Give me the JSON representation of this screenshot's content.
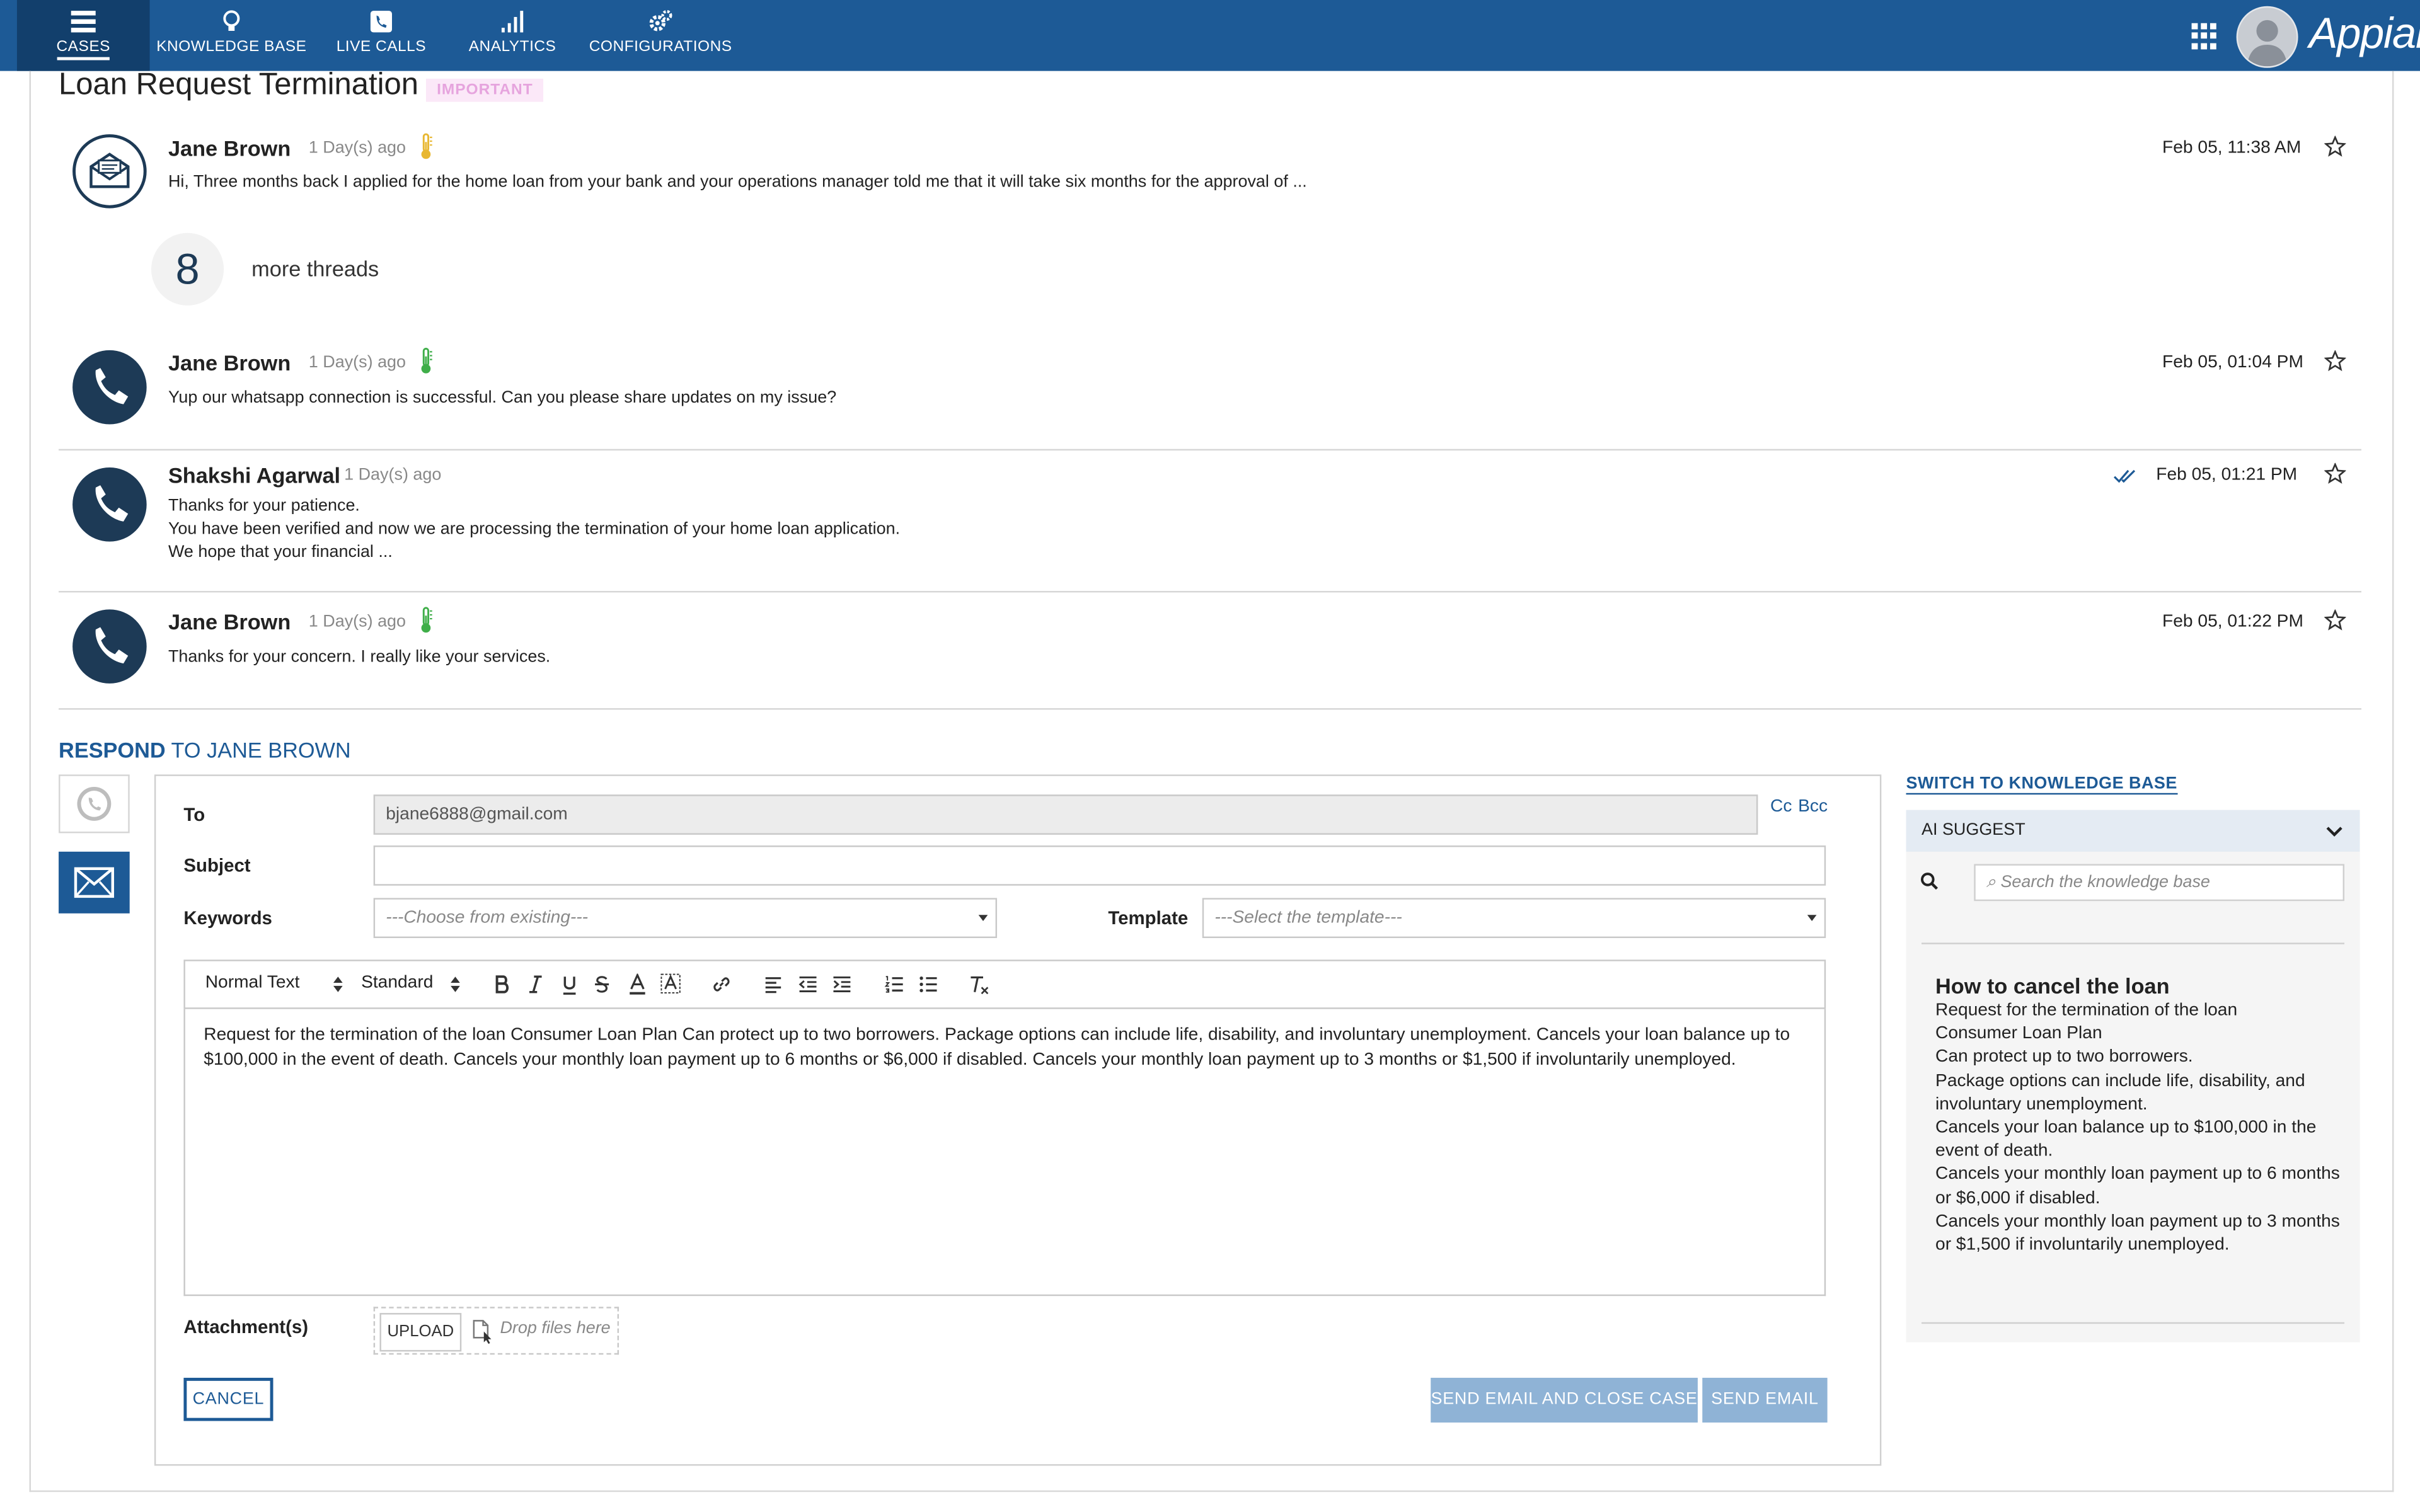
{
  "nav": {
    "items": [
      {
        "label": "CASES",
        "icon": "list-icon"
      },
      {
        "label": "KNOWLEDGE BASE",
        "icon": "lightbulb-icon"
      },
      {
        "label": "LIVE CALLS",
        "icon": "phone-icon"
      },
      {
        "label": "ANALYTICS",
        "icon": "signal-bars-icon"
      },
      {
        "label": "CONFIGURATIONS",
        "icon": "gears-icon"
      }
    ],
    "active": "CASES",
    "brand": "Appian"
  },
  "case": {
    "title": "Loan Request Termination",
    "badge": "IMPORTANT"
  },
  "threads": [
    {
      "name": "Jane Brown",
      "ago": "1 Day(s) ago",
      "date": "Feb 05, 11:38 AM",
      "channel": "email",
      "sentiment": "yellow",
      "text": "Hi, Three months back I applied for the home loan from your bank and your operations manager told me that it will take six months for the approval of ..."
    },
    {
      "name": "Jane Brown",
      "ago": "1 Day(s) ago",
      "date": "Feb 05, 01:04 PM",
      "channel": "whatsapp",
      "sentiment": "green",
      "text": "Yup our whatsapp connection is successful. Can you please share updates on my issue?"
    },
    {
      "name": "Shakshi Agarwal",
      "ago": "1 Day(s) ago",
      "date": "Feb 05, 01:21 PM",
      "channel": "whatsapp",
      "lines": [
        "Thanks for your patience.",
        "You have been verified and now we are processing the termination of your home loan application.",
        "We hope that your financial ..."
      ]
    },
    {
      "name": "Jane Brown",
      "ago": "1 Day(s) ago",
      "date": "Feb 05, 01:22 PM",
      "channel": "whatsapp",
      "sentiment": "green",
      "text": "Thanks for your concern. I really like your services."
    }
  ],
  "more_threads": {
    "count": "8",
    "label": "more threads"
  },
  "respond": {
    "prefix": "RESPOND",
    "suffix": "TO JANE BROWN",
    "to_label": "To",
    "to_value": "bjane6888@gmail.com",
    "cc": "Cc",
    "bcc": "Bcc",
    "subject_label": "Subject",
    "subject_value": "",
    "keywords_label": "Keywords",
    "keywords_placeholder": "---Choose from existing---",
    "template_label": "Template",
    "template_placeholder": "---Select the template---",
    "toolbar": {
      "paragraph": "Normal Text",
      "size": "Standard"
    },
    "body": "Request for the termination of the loan Consumer Loan Plan Can protect up to two borrowers. Package options can include life, disability, and involuntary unemployment. Cancels your loan balance up to $100,000 in the event of death. Cancels your monthly loan payment up to 6 months or $6,000 if disabled. Cancels your monthly loan payment up to 3 months or $1,500 if involuntarily unemployed.",
    "attachments_label": "Attachment(s)",
    "upload_label": "UPLOAD",
    "drop_label": "Drop files here",
    "cancel_label": "CANCEL",
    "send_close_label": "SEND EMAIL AND CLOSE CASE",
    "send_label": "SEND EMAIL"
  },
  "knowledge": {
    "switch_label": "SWITCH TO KNOWLEDGE BASE",
    "panel_label": "AI SUGGEST",
    "search_placeholder": "Search the knowledge base",
    "article_title": "How to cancel the loan",
    "article_lines": [
      "Request for the termination of the loan",
      "Consumer Loan Plan",
      "Can protect up to two borrowers.",
      "Package options can include life, disability, and involuntary unemployment.",
      "Cancels your loan balance up to $100,000 in the event of death.",
      "Cancels your monthly loan payment up to 6 months or $6,000 if disabled.",
      "Cancels your monthly loan payment up to 3 months or $1,500 if involuntarily unemployed."
    ]
  },
  "colors": {
    "nav": "#1d5a96",
    "nav_active": "#123f6c",
    "avatar_dark": "#1d3a56",
    "send_disabled": "#8fb3d6",
    "sentiment_yellow": "#e8b731",
    "sentiment_green": "#3fae49"
  }
}
